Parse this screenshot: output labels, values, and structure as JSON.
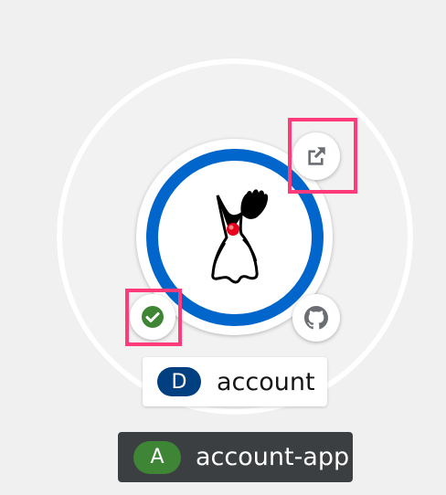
{
  "topology": {
    "application_group": {
      "badge": "A",
      "name": "account-app",
      "badge_color": "#3e8635"
    },
    "workload": {
      "badge": "D",
      "name": "account",
      "badge_color": "#004080",
      "ring_color": "#0066cc",
      "runtime_icon": "java-duke-icon"
    },
    "decorators": {
      "open_url": "external-link-icon",
      "build_status": "check-circle-icon",
      "build_status_color": "#3e8635",
      "source_repo": "github-icon"
    },
    "highlight_color": "#ff3b7a"
  }
}
